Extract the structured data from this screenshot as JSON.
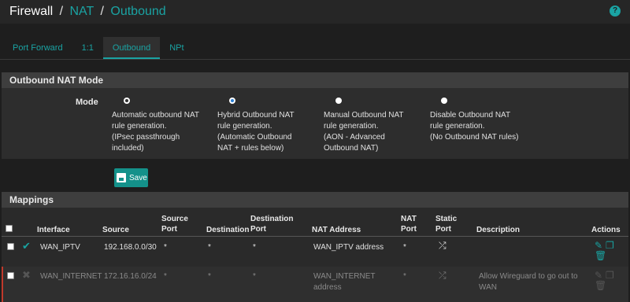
{
  "breadcrumb": {
    "part1": "Firewall",
    "part2": "NAT",
    "part3": "Outbound",
    "separator": "/"
  },
  "help_icon": "?",
  "tabs": [
    {
      "label": "Port Forward"
    },
    {
      "label": "1:1"
    },
    {
      "label": "Outbound"
    },
    {
      "label": "NPt"
    }
  ],
  "active_tab": "Outbound",
  "mode_panel": {
    "title": "Outbound NAT Mode",
    "mode_label": "Mode",
    "options": [
      {
        "lines": [
          "Automatic outbound NAT",
          "rule generation.",
          "(IPsec passthrough",
          "included)"
        ],
        "selected": false
      },
      {
        "lines": [
          "Hybrid Outbound NAT",
          "rule generation.",
          "(Automatic Outbound",
          "NAT + rules below)"
        ],
        "selected": true
      },
      {
        "lines": [
          "Manual Outbound NAT",
          "rule generation.",
          "(AON - Advanced",
          "Outbound NAT)"
        ],
        "selected": false
      },
      {
        "lines": [
          "Disable Outbound NAT",
          "rule generation.",
          "(No Outbound NAT rules)"
        ],
        "selected": false
      }
    ]
  },
  "save_label": "Save",
  "mappings": {
    "title": "Mappings",
    "headers": {
      "interface": "Interface",
      "source": "Source",
      "source_port_1": "Source",
      "source_port_2": "Port",
      "destination": "Destination",
      "dest_port_1": "Destination",
      "dest_port_2": "Port",
      "nat_address": "NAT Address",
      "nat_port_1": "NAT",
      "nat_port_2": "Port",
      "static_port_1": "Static",
      "static_port_2": "Port",
      "description": "Description",
      "actions": "Actions"
    },
    "rows": [
      {
        "interface": "WAN_IPTV",
        "source": "192.168.0.0/30",
        "source_port": "*",
        "destination": "*",
        "dest_port": "*",
        "nat_address": "WAN_IPTV address",
        "nat_address_2": "",
        "nat_port": "*",
        "description": "",
        "description_2": "",
        "enabled": true
      },
      {
        "interface": "WAN_INTERNET",
        "source": "172.16.16.0/24",
        "source_port": "*",
        "destination": "*",
        "dest_port": "*",
        "nat_address": "WAN_INTERNET",
        "nat_address_2": "address",
        "nat_port": "*",
        "description": "Allow Wireguard to go out to",
        "description_2": "WAN",
        "enabled": false
      }
    ]
  },
  "colors": {
    "accent": "#1aa3a3",
    "button": "#14918a",
    "disabled_marker": "#c0392b"
  }
}
